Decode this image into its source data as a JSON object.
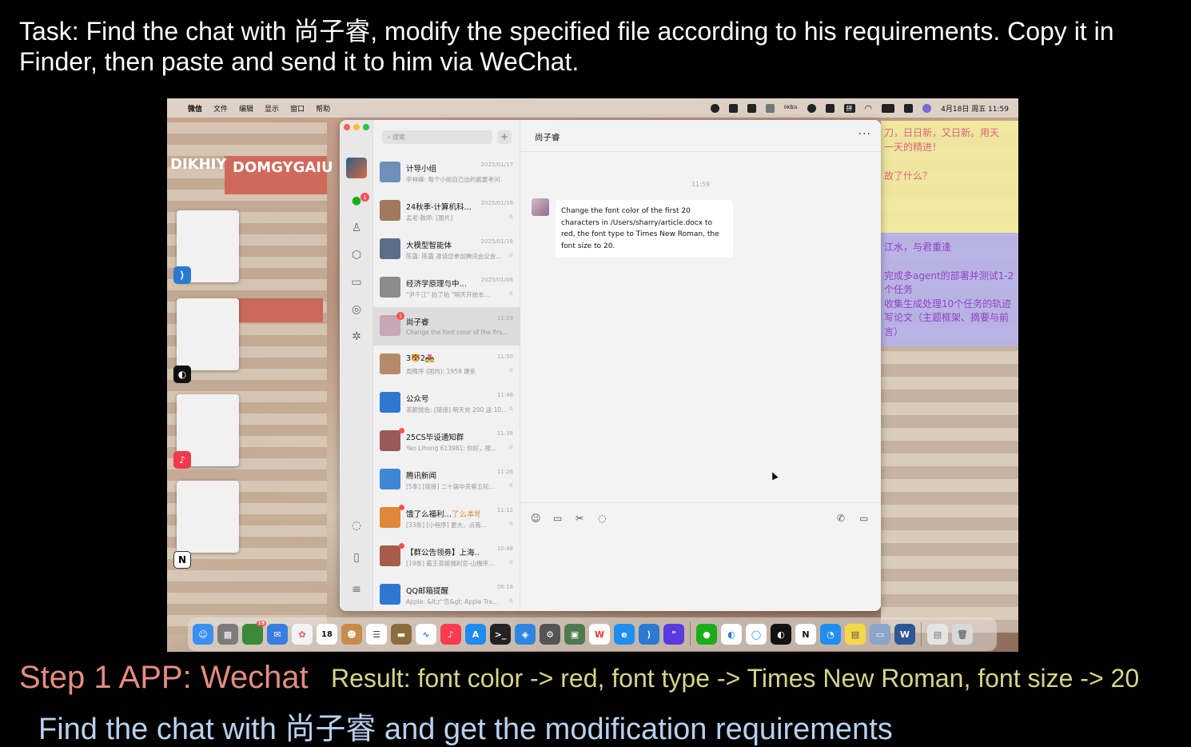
{
  "caption": {
    "task": "Task: Find the chat with 尚子睿, modify the specified file according to his requirements. Copy it in Finder, then paste and send it to him via WeChat.",
    "step_title": "Step 1 APP: Wechat",
    "step_result": "Result: font color -> red, font type -> Times New Roman, font size -> 20",
    "step_desc": "Find the chat with 尚子睿 and get the modification requirements"
  },
  "menubar": {
    "app": "微信",
    "menus": [
      "文件",
      "编辑",
      "显示",
      "窗口",
      "帮助"
    ],
    "net_speed": "0KB/s",
    "input_method": "拼",
    "datetime": "4月18日 周五 11:59"
  },
  "desktop": {
    "words": [
      "DIKHIY",
      "DOMGYGAIU"
    ],
    "sticky_yellow": [
      "刀，日日新，又日新。用天",
      "一天的精进！",
      "故了什么？"
    ],
    "sticky_blue": [
      "江水，与君重逢",
      "完成多agent的部署并测试1-2",
      "个任务",
      "收集生成处理10个任务的轨迹",
      "写论文（主题框架、摘要与前",
      "言）"
    ]
  },
  "wechat": {
    "search_placeholder": "搜索",
    "plus": "+",
    "rail_badge": "1",
    "chats": [
      {
        "name": "计导小组",
        "time": "2025/01/17",
        "msg": "李林峰: 每个小组自己出的题要考问"
      },
      {
        "name": "24秋季-计算机科…",
        "time": "2025/01/16",
        "msg": "孟老·教师: [图片]"
      },
      {
        "name": "大模型智能体",
        "time": "2025/01/16",
        "msg": "陈露: 陈露 邀请您参加腾讯会议会…"
      },
      {
        "name": "经济学原理与中…",
        "time": "2025/01/08",
        "msg": "\"尹千江\" 拍了拍 \"明天开始长…"
      },
      {
        "name": "尚子睿",
        "time": "11:59",
        "msg": "Change the font color of the firs…",
        "badge": "1"
      },
      {
        "name": "3🐯2💑",
        "time": "11:50",
        "msg": "周障序 (国内): 1958 建系"
      },
      {
        "name": "公众号",
        "time": "11:46",
        "msg": "茶颜悦色: [链接] 明天充 200 送 10…"
      },
      {
        "name": "25CS毕设通知群",
        "time": "11:38",
        "msg": "Yao Lihong 613981: 你好，按…"
      },
      {
        "name": "腾讯新闻",
        "time": "11:26",
        "msg": "[5条] [链接] 二十届中央第五轮…"
      },
      {
        "name": "饿了么福利…",
        "tag": "了么本地生活",
        "time": "11:12",
        "msg": "[33条] [小程序] 更大，点我…"
      },
      {
        "name": "【群公告领劵】上海…",
        "time": "10:48",
        "msg": "[19条] 霸王茶姬福利官-山槐序…"
      },
      {
        "name": "QQ邮箱提醒",
        "time": "06:18",
        "msg": "Apple: &lt;广告&gt; Apple Tra…"
      }
    ],
    "chat": {
      "title": "尚子睿",
      "more": "···",
      "timestamp": "11:59",
      "message": "Change the font color of the first 20 characters in /Users/sharry/article.docx to red, the font type to Times New Roman, the font size to 20."
    }
  },
  "dock": {
    "mail_badge": "19",
    "calendar_day": "18"
  }
}
